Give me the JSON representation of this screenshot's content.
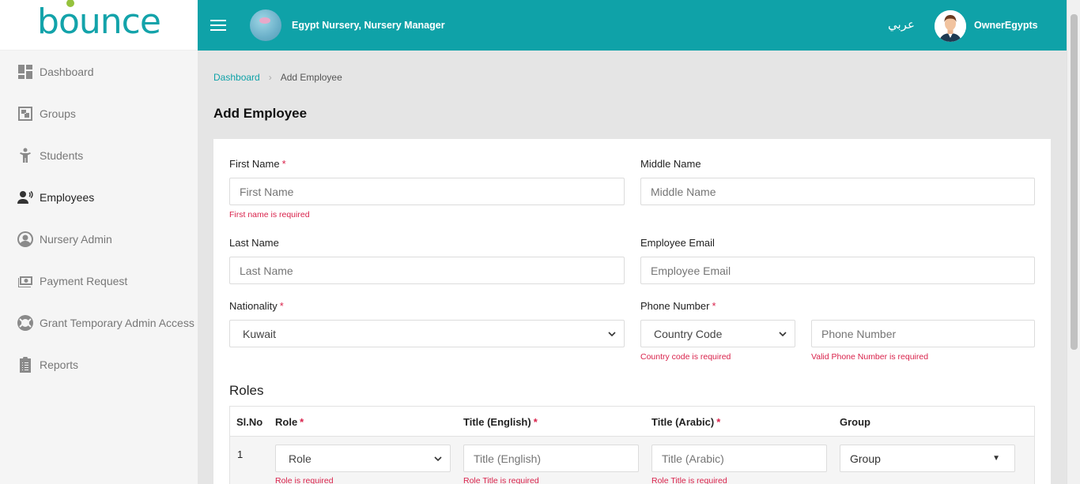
{
  "sidebar": {
    "logo": "bounce",
    "items": [
      {
        "label": "Dashboard",
        "icon": "dashboard-icon"
      },
      {
        "label": "Groups",
        "icon": "groups-icon"
      },
      {
        "label": "Students",
        "icon": "students-icon"
      },
      {
        "label": "Employees",
        "icon": "employees-icon"
      },
      {
        "label": "Nursery Admin",
        "icon": "nursery-admin-icon"
      },
      {
        "label": "Payment Request",
        "icon": "payment-icon"
      },
      {
        "label": "Grant Temporary Admin Access",
        "icon": "lifebuoy-icon"
      },
      {
        "label": "Reports",
        "icon": "clipboard-icon"
      }
    ]
  },
  "header": {
    "nursery_name": "Egypt Nursery, Nursery Manager",
    "language_toggle": "عربي",
    "user_name": "OwnerEgypts",
    "color": "#0fa2a8"
  },
  "breadcrumb": {
    "home": "Dashboard",
    "current": "Add Employee"
  },
  "page_title": "Add Employee",
  "form": {
    "first_name": {
      "label": "First Name",
      "placeholder": "First Name",
      "error": "First name is required"
    },
    "middle_name": {
      "label": "Middle Name",
      "placeholder": "Middle Name"
    },
    "last_name": {
      "label": "Last Name",
      "placeholder": "Last Name"
    },
    "email": {
      "label": "Employee Email",
      "placeholder": "Employee Email"
    },
    "nationality": {
      "label": "Nationality",
      "value": "Kuwait"
    },
    "phone": {
      "label": "Phone Number",
      "country_code": "Country Code",
      "country_code_error": "Country code is required",
      "placeholder": "Phone Number",
      "error": "Valid Phone Number is required"
    },
    "required_mark": "*"
  },
  "roles": {
    "title": "Roles",
    "columns": {
      "sl": "Sl.No",
      "role": "Role",
      "title_en": "Title (English)",
      "title_ar": "Title (Arabic)",
      "group": "Group"
    },
    "rows": [
      {
        "sl": "1",
        "role": "Role",
        "role_error": "Role is required",
        "title_en_placeholder": "Title (English)",
        "title_en_error": "Role Title is required",
        "title_ar_placeholder": "Title (Arabic)",
        "title_ar_error": "Role Title is required",
        "group": "Group"
      }
    ]
  }
}
